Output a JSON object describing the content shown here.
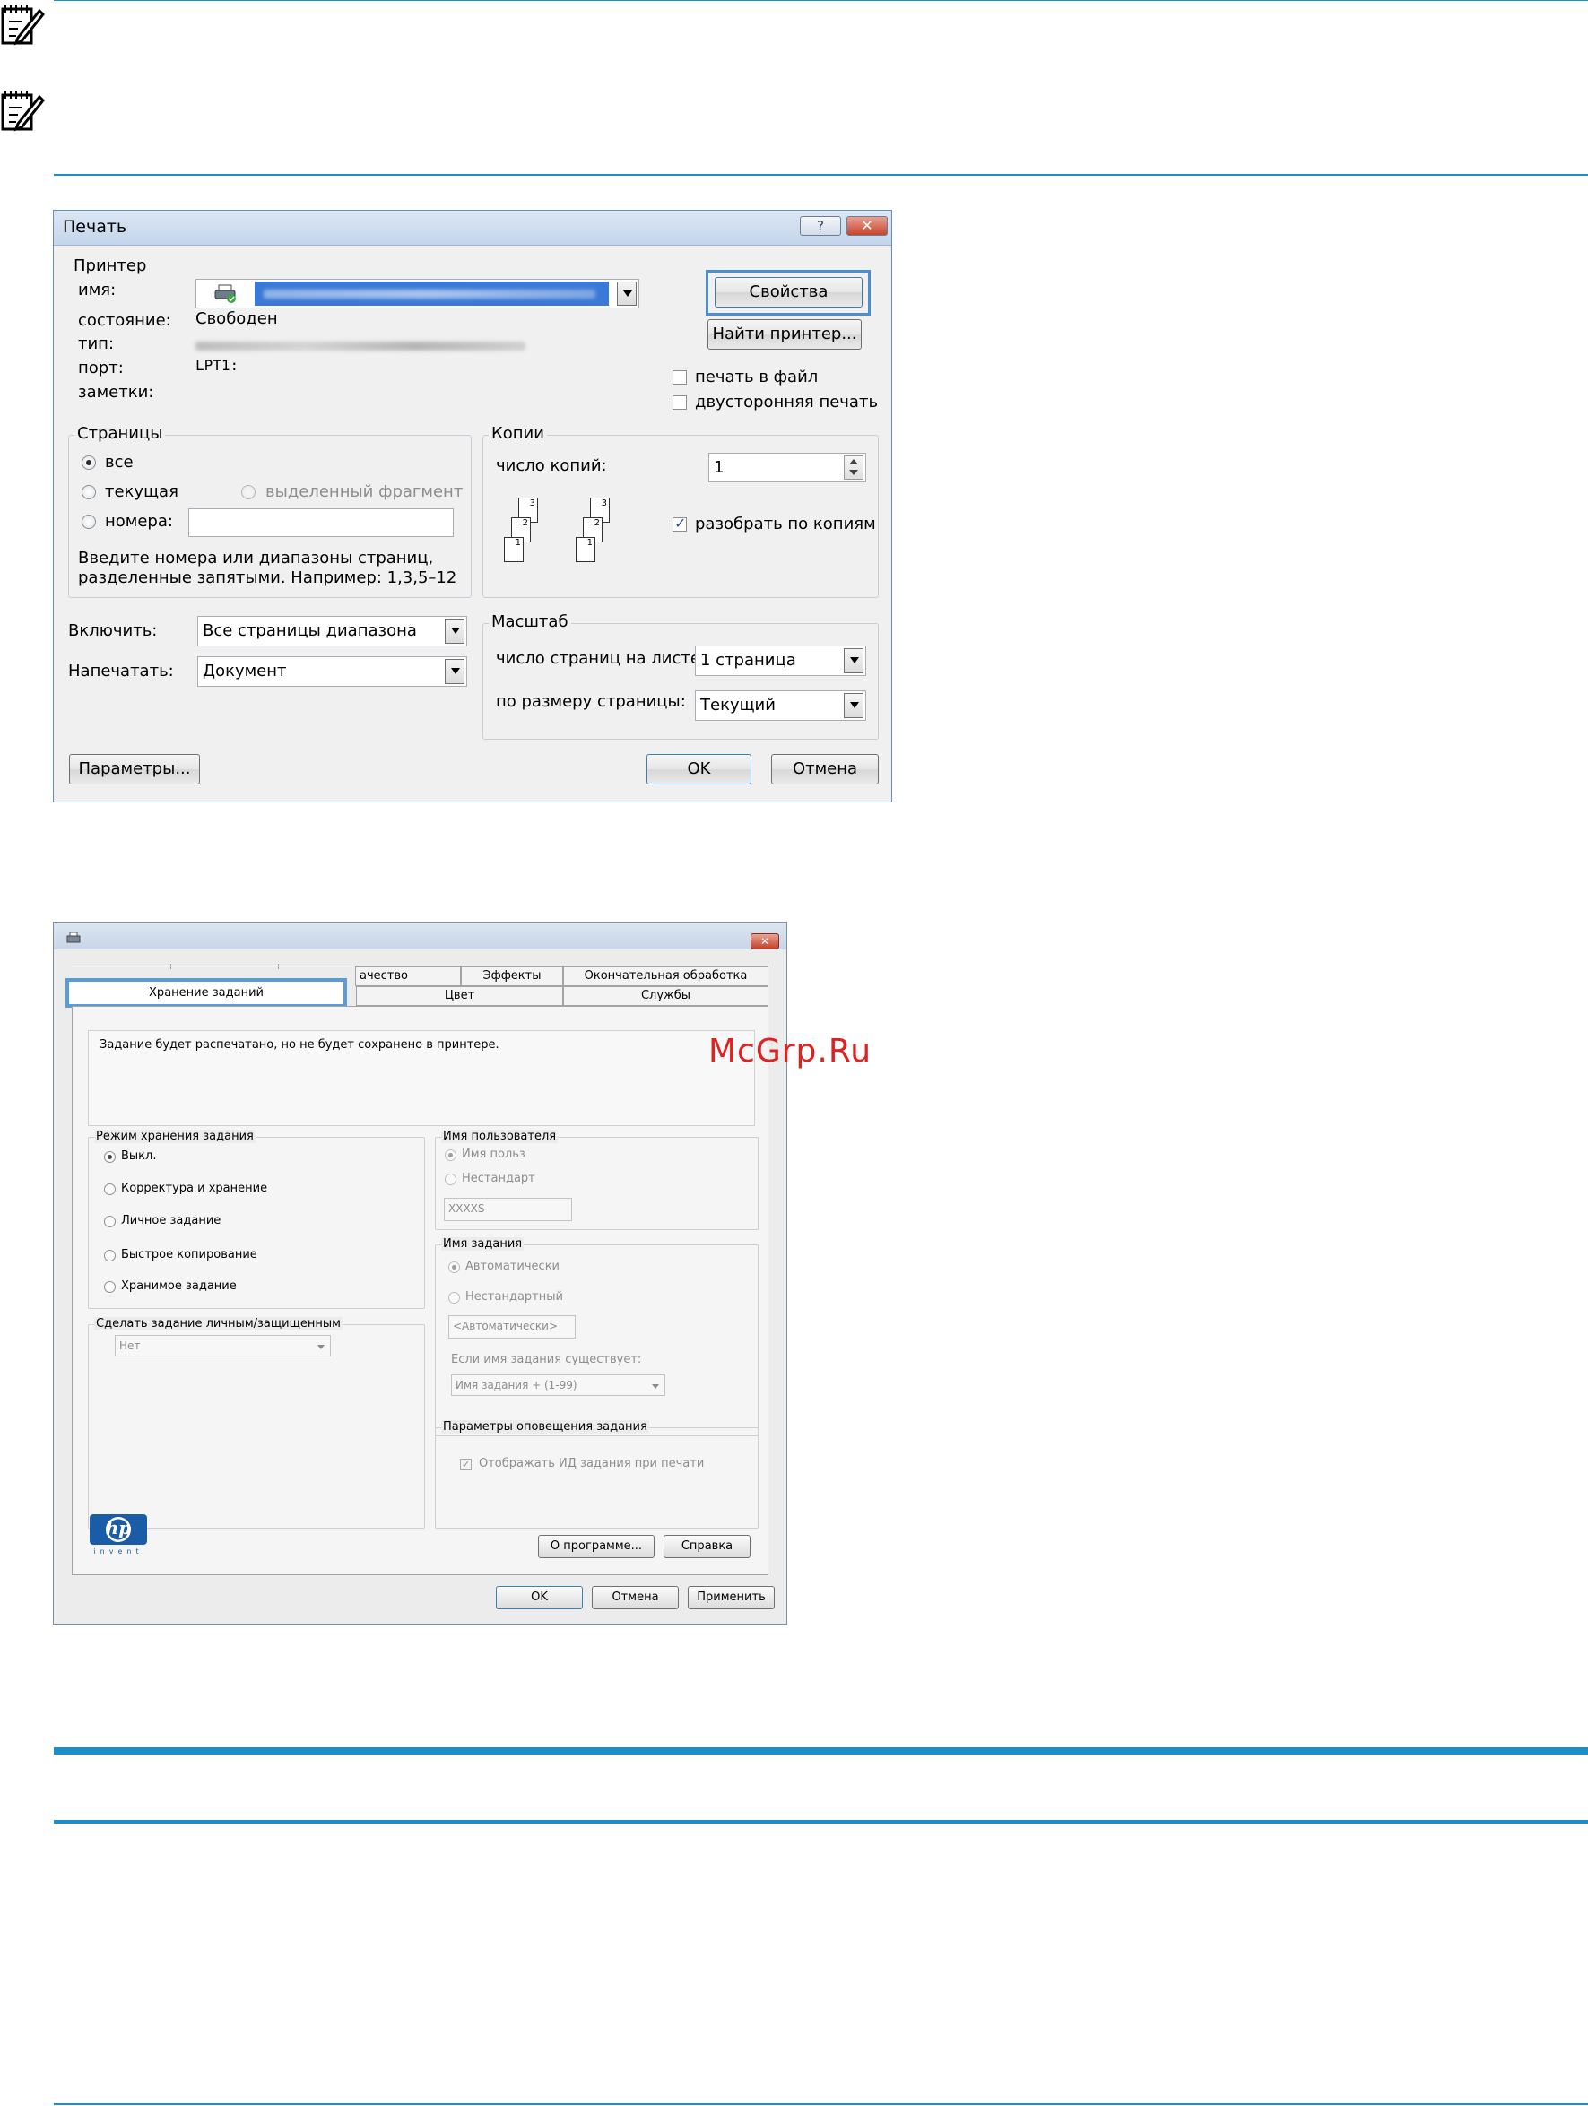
{
  "print_dialog": {
    "title": "Печать",
    "help_label": "?",
    "close_label": "✕",
    "printer_group": "Принтер",
    "name_label": "имя:",
    "status_label": "состояние:",
    "status_value": "Свободен",
    "type_label": "тип:",
    "port_label": "порт:",
    "port_value": "LPT1:",
    "comment_label": "заметки:",
    "properties_button": "Свойства",
    "find_printer_button": "Найти принтер...",
    "print_to_file": "печать в файл",
    "duplex": "двусторонняя печать",
    "pages_group": "Страницы",
    "pages_all": "все",
    "pages_current": "текущая",
    "pages_selection": "выделенный фрагмент",
    "pages_numbers": "номера:",
    "pages_hint_1": "Введите номера или диапазоны страниц,",
    "pages_hint_2": "разделенные запятыми. Например: 1,3,5–12",
    "copies_group": "Копии",
    "copies_label": "число копий:",
    "copies_value": "1",
    "collate": "разобрать по копиям",
    "include_label": "Включить:",
    "include_value": "Все страницы диапазона",
    "print_what_label": "Напечатать:",
    "print_what_value": "Документ",
    "zoom_group": "Масштаб",
    "pages_per_sheet_label": "число страниц на листе:",
    "pages_per_sheet_value": "1 страница",
    "scale_label": "по размеру страницы:",
    "scale_value": "Текущий",
    "options_button": "Параметры...",
    "ok_button": "OK",
    "cancel_button": "Отмена"
  },
  "hp_dialog": {
    "close_label": "✕",
    "tabs_row1": [
      "ачество",
      "Эффекты",
      "Окончательная обработка"
    ],
    "tabs_row2": [
      "Хранение заданий",
      "Цвет",
      "Службы"
    ],
    "info_text": "Задание будет распечатано, но не будет сохранено в принтере.",
    "mode_group": "Режим хранения задания",
    "modes": [
      "Выкл.",
      "Корректура и хранение",
      "Личное задание",
      "Быстрое копирование",
      "Хранимое задание"
    ],
    "private_group": "Сделать задание личным/защищенным",
    "private_value": "Нет",
    "user_group": "Имя пользователя",
    "user_opt1": "Имя польз",
    "user_opt2": "Нестандарт",
    "user_value": "XXXXS",
    "job_group": "Имя задания",
    "job_opt1": "Автоматически",
    "job_opt2": "Нестандартный",
    "job_value": "<Автоматически>",
    "job_exists_label": "Если имя задания существует:",
    "job_exists_value": "Имя задания + (1-99)",
    "notify_group": "Параметры оповещения задания",
    "notify_check": "Отображать ИД задания при печати",
    "hp_logo": "hp",
    "hp_invent": "invent",
    "about_button": "О программе...",
    "help_button": "Справка",
    "ok_button": "OK",
    "cancel_button": "Отмена",
    "apply_button": "Применить"
  },
  "watermark": "McGrp.Ru",
  "colors": {
    "rule": "#1a8fc8",
    "highlight": "#4b8ed6"
  }
}
